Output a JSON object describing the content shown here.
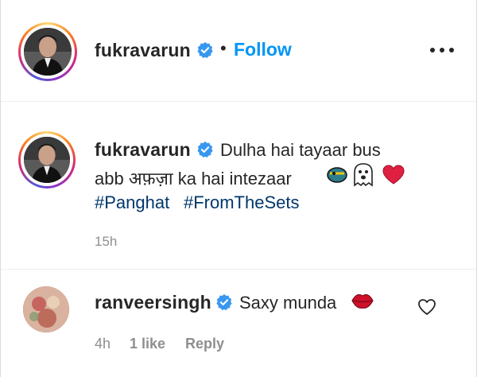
{
  "post_header": {
    "username": "fukravarun",
    "separator": "•",
    "follow_label": "Follow",
    "more_icon": "more-options-icon"
  },
  "caption": {
    "username": "fukravarun",
    "text_line1": "Dulha hai tayaar bus",
    "text_line2": "abb अफ़ज़ा ka hai intezaar",
    "emojis": [
      "wink-tongue-emoji",
      "ghost-emoji",
      "red-heart-emoji"
    ],
    "hashtags": [
      "#Panghat",
      "#FromTheSets"
    ],
    "timestamp": "15h"
  },
  "comment": {
    "username": "ranveersingh",
    "text": "Saxy munda",
    "emoji": "lips-emoji",
    "time": "4h",
    "likes": "1 like",
    "reply_label": "Reply",
    "like_icon": "heart-outline-icon"
  },
  "colors": {
    "accent": "#0095f6",
    "hashtag": "#00376b",
    "verified": "#3897f0",
    "muted": "#8e8e8e",
    "text": "#262626"
  }
}
